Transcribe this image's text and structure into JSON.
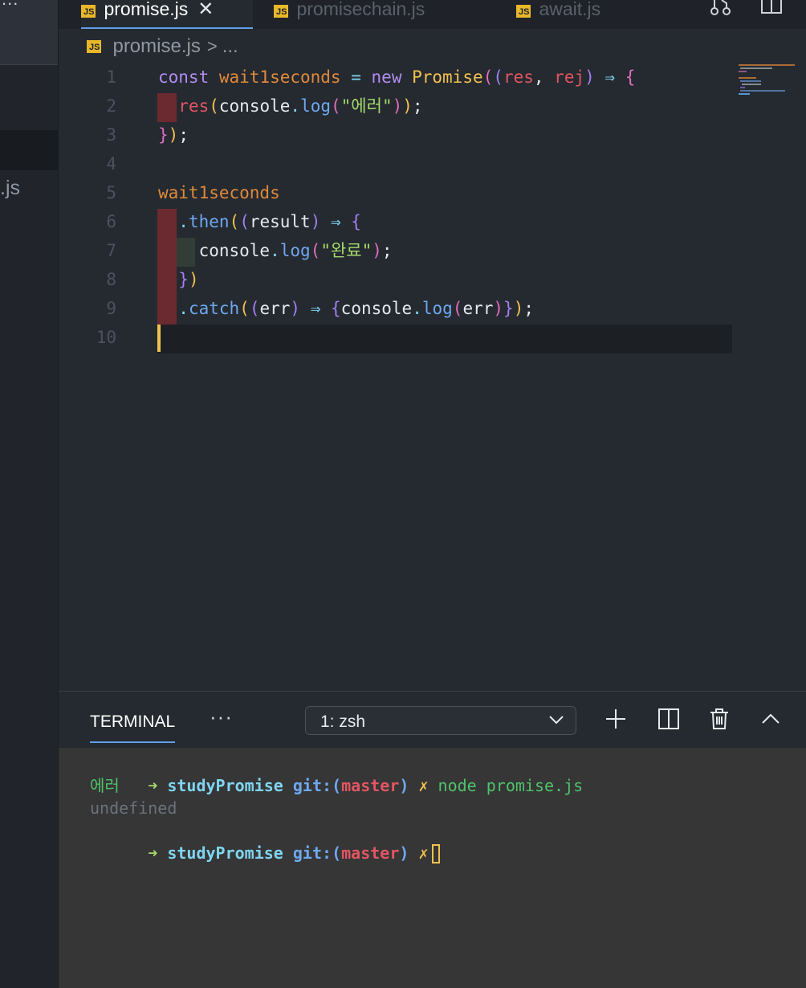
{
  "sidebar": {
    "more_label": "...",
    "file_label": ".js"
  },
  "tabs": [
    {
      "badge": "JS",
      "label": "promise.js",
      "active": true
    },
    {
      "badge": "JS",
      "label": "promisechain.js",
      "active": false
    },
    {
      "badge": "JS",
      "label": "await.js",
      "active": false
    }
  ],
  "breadcrumb": {
    "badge": "JS",
    "file": "promise.js",
    "separator": ">",
    "more": "..."
  },
  "editor": {
    "lines": [
      {
        "n": "1",
        "tokens": [
          [
            "kw",
            "const "
          ],
          [
            "var",
            "wait1seconds "
          ],
          [
            "op",
            "= "
          ],
          [
            "kw",
            "new "
          ],
          [
            "cls",
            "Promise"
          ],
          [
            "paren1",
            "("
          ],
          [
            "paren2",
            "("
          ],
          [
            "param",
            "res"
          ],
          [
            "plain",
            ", "
          ],
          [
            "param",
            "rej"
          ],
          [
            "paren2",
            ")"
          ],
          [
            "op",
            " ⇒ "
          ],
          [
            "paren1",
            "{"
          ]
        ]
      },
      {
        "n": "2",
        "tokens": [
          [
            "plain",
            "  "
          ],
          [
            "param",
            "res"
          ],
          [
            "paren3",
            "("
          ],
          [
            "plain",
            "console"
          ],
          [
            "dot",
            "."
          ],
          [
            "fn",
            "log"
          ],
          [
            "paren1",
            "("
          ],
          [
            "str",
            "\"에러\""
          ],
          [
            "paren1",
            ")"
          ],
          [
            "paren3",
            ")"
          ],
          [
            "plain",
            ";"
          ]
        ]
      },
      {
        "n": "3",
        "tokens": [
          [
            "paren1",
            "}"
          ],
          [
            "paren3",
            ")"
          ],
          [
            "plain",
            ";"
          ]
        ]
      },
      {
        "n": "4",
        "tokens": []
      },
      {
        "n": "5",
        "tokens": [
          [
            "var",
            "wait1seconds"
          ]
        ]
      },
      {
        "n": "6",
        "tokens": [
          [
            "plain",
            "  "
          ],
          [
            "dot",
            "."
          ],
          [
            "fn",
            "then"
          ],
          [
            "paren3",
            "("
          ],
          [
            "paren2",
            "("
          ],
          [
            "plain",
            "result"
          ],
          [
            "paren2",
            ")"
          ],
          [
            "op",
            " ⇒ "
          ],
          [
            "paren2",
            "{"
          ]
        ]
      },
      {
        "n": "7",
        "tokens": [
          [
            "plain",
            "    console"
          ],
          [
            "dot",
            "."
          ],
          [
            "fn",
            "log"
          ],
          [
            "paren1",
            "("
          ],
          [
            "str",
            "\"완료\""
          ],
          [
            "paren1",
            ")"
          ],
          [
            "plain",
            ";"
          ]
        ]
      },
      {
        "n": "8",
        "tokens": [
          [
            "plain",
            "  "
          ],
          [
            "paren2",
            "}"
          ],
          [
            "paren3",
            ")"
          ]
        ]
      },
      {
        "n": "9",
        "tokens": [
          [
            "plain",
            "  "
          ],
          [
            "dot",
            "."
          ],
          [
            "fn",
            "catch"
          ],
          [
            "paren3",
            "("
          ],
          [
            "paren2",
            "("
          ],
          [
            "plain",
            "err"
          ],
          [
            "paren2",
            ")"
          ],
          [
            "op",
            " ⇒ "
          ],
          [
            "paren2",
            "{"
          ],
          [
            "plain",
            "console"
          ],
          [
            "dot",
            "."
          ],
          [
            "fn",
            "log"
          ],
          [
            "paren1",
            "("
          ],
          [
            "plain",
            "err"
          ],
          [
            "paren1",
            ")"
          ],
          [
            "paren2",
            "}"
          ],
          [
            "paren3",
            ")"
          ],
          [
            "plain",
            ";"
          ]
        ]
      },
      {
        "n": "10",
        "tokens": []
      }
    ]
  },
  "panel": {
    "tab_label": "TERMINAL",
    "more_label": "···",
    "shell_select": "1: zsh"
  },
  "terminal": {
    "prompt_arrow": "➜",
    "dir": "studyPromise",
    "git_prefix": "git:",
    "paren_open": "(",
    "branch": "master",
    "paren_close": ")",
    "dirty_mark": "✗",
    "command": "node promise.js",
    "output_1": "에러",
    "output_2": "undefined"
  },
  "colors": {
    "background": "#252a30",
    "accent": "#5fa1e8",
    "js_badge": "#e8b72a",
    "caret": "#f2c14e"
  }
}
